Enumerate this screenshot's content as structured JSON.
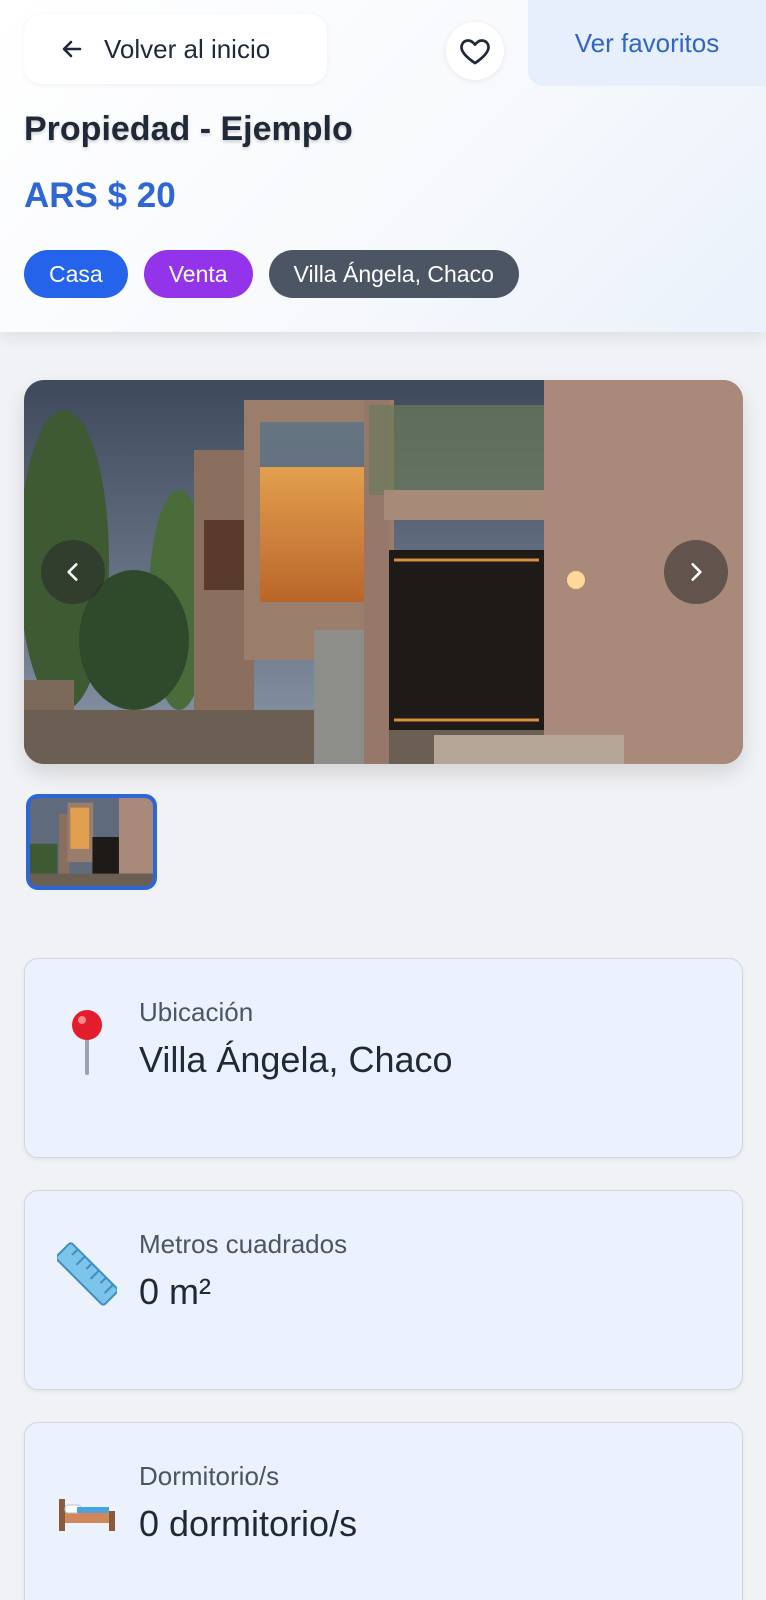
{
  "header": {
    "back_label": "Volver al inicio",
    "favorites_label": "Ver favoritos",
    "title": "Propiedad - Ejemplo",
    "price": "ARS $ 20",
    "badges": [
      {
        "label": "Casa",
        "color": "#2563eb"
      },
      {
        "label": "Venta",
        "color": "#9333ea"
      },
      {
        "label": "Villa Ángela, Chaco",
        "color": "#4b5563"
      }
    ]
  },
  "gallery": {
    "main_image": "house-photo",
    "prev_icon": "chevron-left-icon",
    "next_icon": "chevron-right-icon",
    "thumbnails": 1
  },
  "details": [
    {
      "icon": "pin-icon",
      "label": "Ubicación",
      "value": "Villa Ángela, Chaco"
    },
    {
      "icon": "ruler-icon",
      "label": "Metros cuadrados",
      "value": "0 m²"
    },
    {
      "icon": "bed-icon",
      "label": "Dormitorio/s",
      "value": "0 dormitorio/s"
    }
  ],
  "colors": {
    "accent": "#2f66d6",
    "favorites_bg": "#e6effb",
    "card_bg": "#ebf2fd"
  }
}
